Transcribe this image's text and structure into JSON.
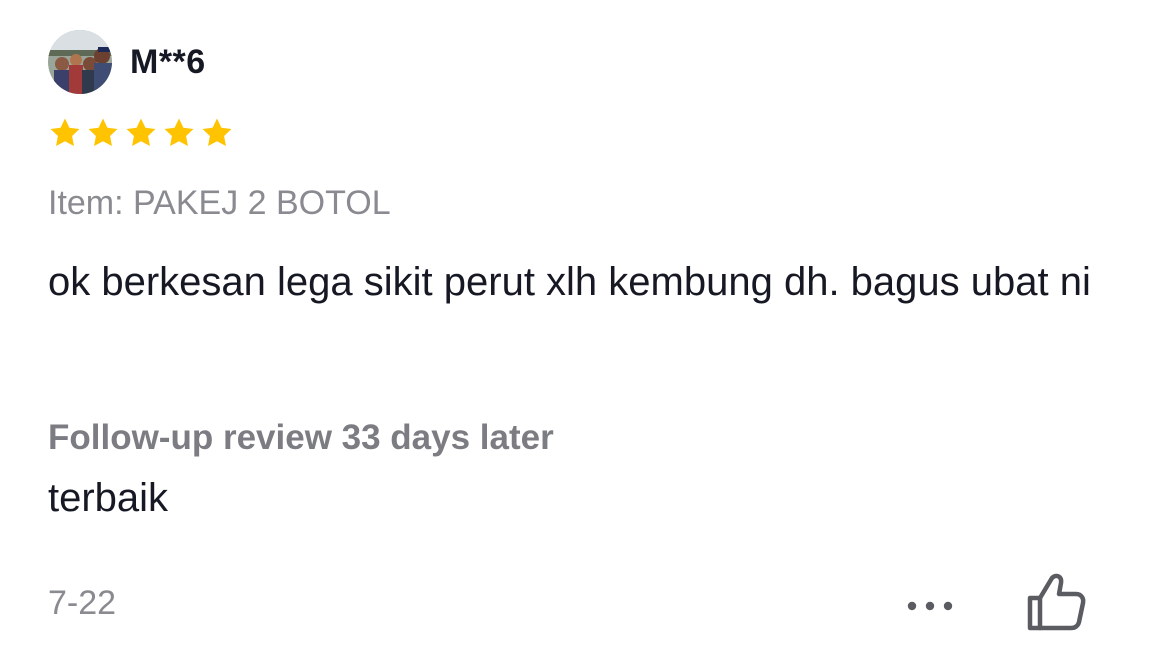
{
  "review": {
    "username": "M**6",
    "rating": 5,
    "rating_max": 5,
    "star_color": "#FFC300",
    "item_label": "Item: PAKEJ 2 BOTOL",
    "text": "ok berkesan lega sikit perut xlh kembung dh. bagus ubat ni",
    "followup_label": "Follow-up review 33 days later",
    "followup_text": "terbaik",
    "date": "7-22",
    "icons": {
      "more": "more-options-icon",
      "like": "thumbs-up-icon",
      "avatar": "user-avatar"
    }
  }
}
